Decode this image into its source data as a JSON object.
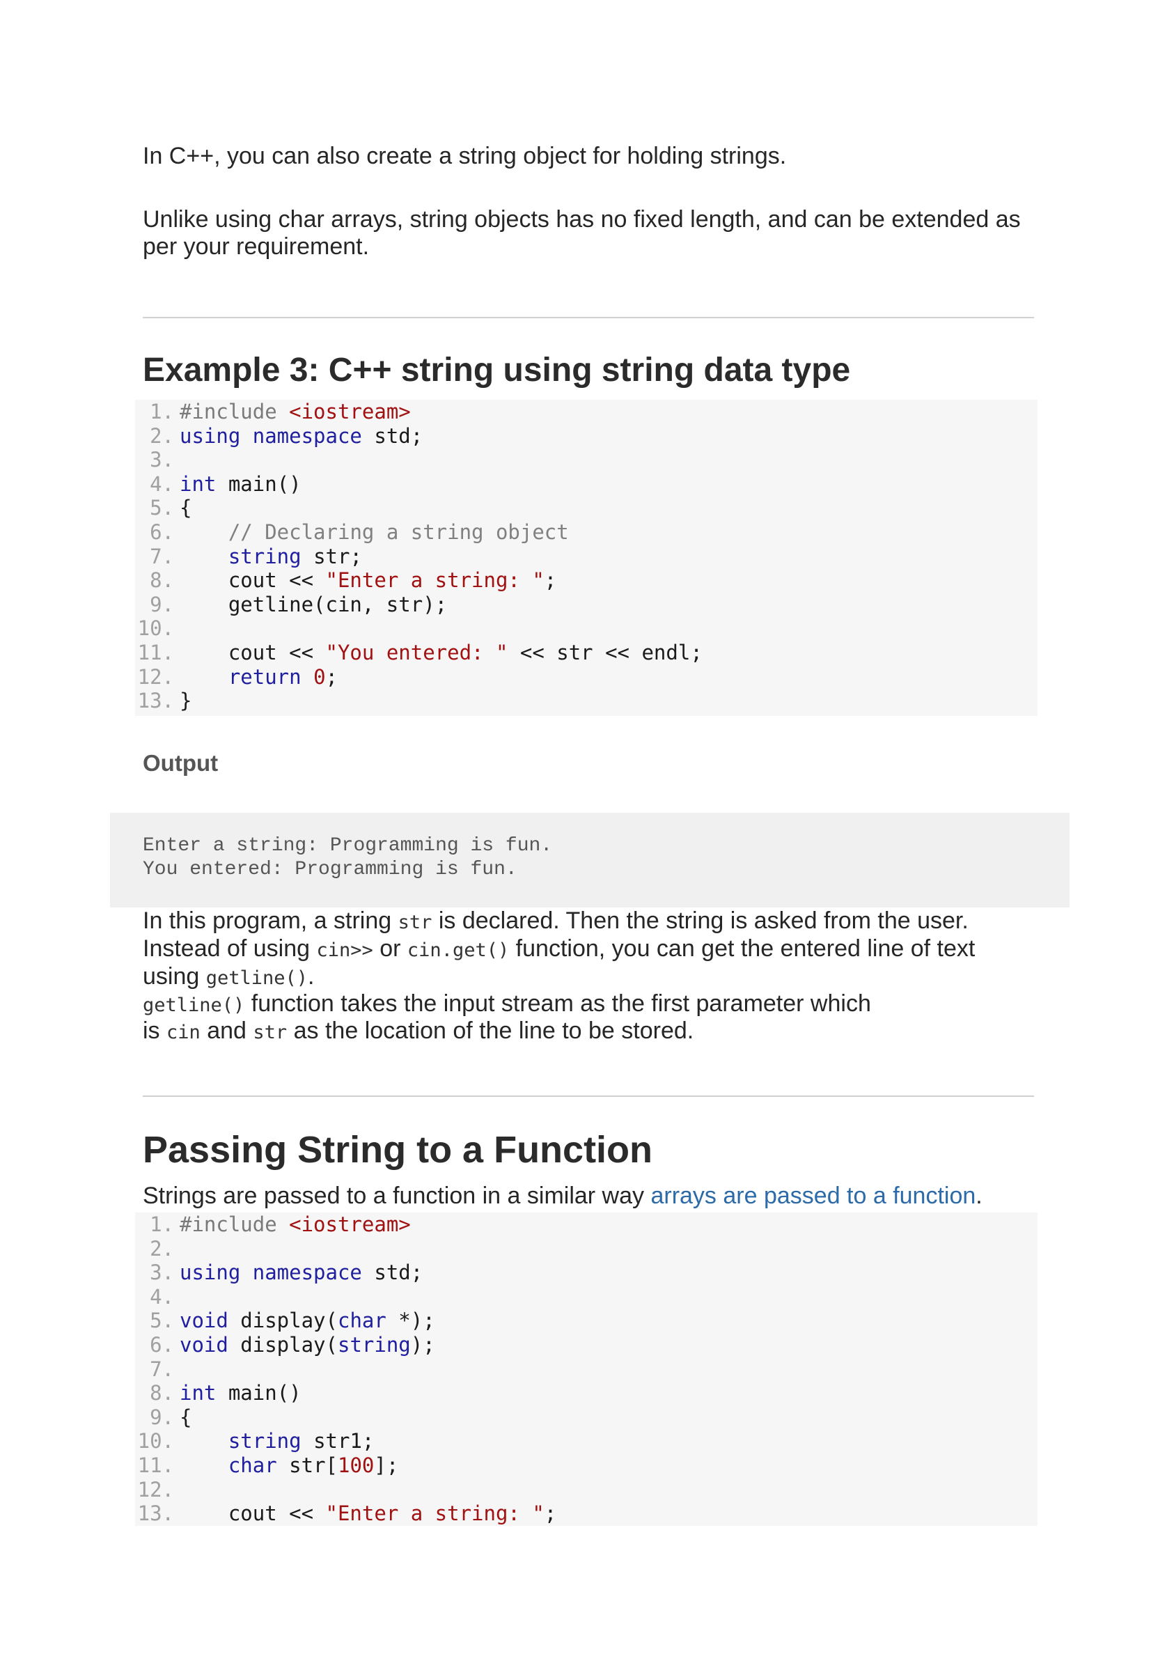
{
  "intro": {
    "p1": "In C++, you can also create a string object for holding strings.",
    "p2": "Unlike using char arrays, string objects has no fixed length, and can be extended as per your requirement."
  },
  "example3": {
    "title": "Example 3: C++ string using string data type",
    "code": [
      {
        "n": "1.",
        "tokens": [
          {
            "t": "#include ",
            "c": "pp"
          },
          {
            "t": "<iostream>",
            "c": "inc"
          }
        ]
      },
      {
        "n": "2.",
        "tokens": [
          {
            "t": "using namespace",
            "c": "kw"
          },
          {
            "t": " std;",
            "c": ""
          }
        ]
      },
      {
        "n": "3.",
        "tokens": []
      },
      {
        "n": "4.",
        "tokens": [
          {
            "t": "int",
            "c": "kw"
          },
          {
            "t": " main()",
            "c": ""
          }
        ]
      },
      {
        "n": "5.",
        "tokens": [
          {
            "t": "{",
            "c": ""
          }
        ]
      },
      {
        "n": "6.",
        "tokens": [
          {
            "t": "    ",
            "c": ""
          },
          {
            "t": "// Declaring a string object",
            "c": "cm"
          }
        ]
      },
      {
        "n": "7.",
        "tokens": [
          {
            "t": "    ",
            "c": ""
          },
          {
            "t": "string",
            "c": "kw"
          },
          {
            "t": " str;",
            "c": ""
          }
        ]
      },
      {
        "n": "8.",
        "tokens": [
          {
            "t": "    cout << ",
            "c": ""
          },
          {
            "t": "\"Enter a string: \"",
            "c": "str"
          },
          {
            "t": ";",
            "c": ""
          }
        ]
      },
      {
        "n": "9.",
        "tokens": [
          {
            "t": "    getline(cin, str);",
            "c": ""
          }
        ]
      },
      {
        "n": "10.",
        "tokens": []
      },
      {
        "n": "11.",
        "tokens": [
          {
            "t": "    cout << ",
            "c": ""
          },
          {
            "t": "\"You entered: \"",
            "c": "str"
          },
          {
            "t": " << str << endl;",
            "c": ""
          }
        ]
      },
      {
        "n": "12.",
        "tokens": [
          {
            "t": "    ",
            "c": ""
          },
          {
            "t": "return",
            "c": "kw"
          },
          {
            "t": " ",
            "c": ""
          },
          {
            "t": "0",
            "c": "num"
          },
          {
            "t": ";",
            "c": ""
          }
        ]
      },
      {
        "n": "13.",
        "tokens": [
          {
            "t": "}",
            "c": ""
          }
        ]
      }
    ]
  },
  "output": {
    "heading": "Output",
    "lines": [
      "Enter a string: Programming is fun.",
      "You entered: Programming is fun."
    ]
  },
  "explanation": {
    "l1_a": "In this program, a string ",
    "l1_code": "str",
    "l1_b": " is declared. Then the string is asked from the user.",
    "l2_a": "Instead of using ",
    "l2_code1": "cin>>",
    "l2_b": " or ",
    "l2_code2": "cin.get()",
    "l2_c": " function, you can get the entered line of text",
    "l3_a": "using ",
    "l3_code": "getline()",
    "l3_b": ".",
    "l4_code": "getline()",
    "l4_b": " function takes the input stream as the first parameter which",
    "l5_a": "is ",
    "l5_code1": "cin",
    "l5_b": " and ",
    "l5_code2": "str",
    "l5_c": " as the location of the line to be stored."
  },
  "passing": {
    "title": "Passing String to a Function",
    "intro_a": "Strings are passed to a function in a similar way ",
    "intro_link": "arrays are passed to a function",
    "intro_b": ".",
    "code": [
      {
        "n": "1.",
        "tokens": [
          {
            "t": "#include ",
            "c": "pp"
          },
          {
            "t": "<iostream>",
            "c": "inc"
          }
        ]
      },
      {
        "n": "2.",
        "tokens": []
      },
      {
        "n": "3.",
        "tokens": [
          {
            "t": "using namespace",
            "c": "kw"
          },
          {
            "t": " std;",
            "c": ""
          }
        ]
      },
      {
        "n": "4.",
        "tokens": []
      },
      {
        "n": "5.",
        "tokens": [
          {
            "t": "void",
            "c": "kw"
          },
          {
            "t": " display(",
            "c": ""
          },
          {
            "t": "char",
            "c": "kw"
          },
          {
            "t": " *);",
            "c": ""
          }
        ]
      },
      {
        "n": "6.",
        "tokens": [
          {
            "t": "void",
            "c": "kw"
          },
          {
            "t": " display(",
            "c": ""
          },
          {
            "t": "string",
            "c": "kw"
          },
          {
            "t": ");",
            "c": ""
          }
        ]
      },
      {
        "n": "7.",
        "tokens": []
      },
      {
        "n": "8.",
        "tokens": [
          {
            "t": "int",
            "c": "kw"
          },
          {
            "t": " main()",
            "c": ""
          }
        ]
      },
      {
        "n": "9.",
        "tokens": [
          {
            "t": "{",
            "c": ""
          }
        ]
      },
      {
        "n": "10.",
        "tokens": [
          {
            "t": "    ",
            "c": ""
          },
          {
            "t": "string",
            "c": "kw"
          },
          {
            "t": " str1;",
            "c": ""
          }
        ]
      },
      {
        "n": "11.",
        "tokens": [
          {
            "t": "    ",
            "c": ""
          },
          {
            "t": "char",
            "c": "kw"
          },
          {
            "t": " str[",
            "c": ""
          },
          {
            "t": "100",
            "c": "num"
          },
          {
            "t": "];",
            "c": ""
          }
        ]
      },
      {
        "n": "12.",
        "tokens": []
      },
      {
        "n": "13.",
        "tokens": [
          {
            "t": "    cout << ",
            "c": ""
          },
          {
            "t": "\"Enter a string: \"",
            "c": "str"
          },
          {
            "t": ";",
            "c": ""
          }
        ]
      }
    ]
  }
}
